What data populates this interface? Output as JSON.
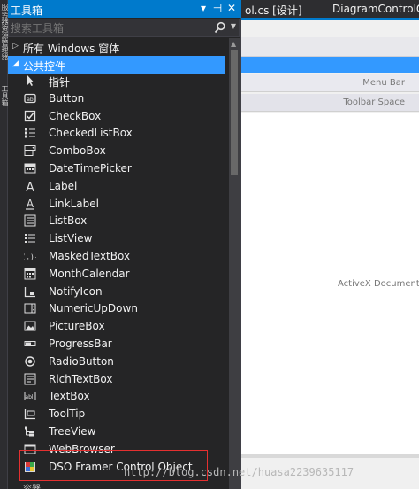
{
  "vertical_strip": {
    "labels": [
      "服务器资源管理器",
      "工具箱"
    ]
  },
  "toolbox": {
    "title": "工具箱",
    "controls": {
      "dropdown": "▾",
      "pin": "⊣",
      "close": "✕"
    },
    "search": {
      "placeholder": "搜索工具箱",
      "value": ""
    },
    "groups": {
      "windows": {
        "label": "所有 Windows 窗体",
        "expanded": false
      },
      "common": {
        "label": "公共控件",
        "expanded": true
      },
      "next": {
        "label": "容器"
      }
    },
    "items": [
      {
        "name": "指针",
        "icon": "pointer-icon"
      },
      {
        "name": "Button",
        "icon": "button-icon"
      },
      {
        "name": "CheckBox",
        "icon": "checkbox-icon"
      },
      {
        "name": "CheckedListBox",
        "icon": "checkedlistbox-icon"
      },
      {
        "name": "ComboBox",
        "icon": "combobox-icon"
      },
      {
        "name": "DateTimePicker",
        "icon": "datetimepicker-icon"
      },
      {
        "name": "Label",
        "icon": "label-icon"
      },
      {
        "name": "LinkLabel",
        "icon": "linklabel-icon"
      },
      {
        "name": "ListBox",
        "icon": "listbox-icon"
      },
      {
        "name": "ListView",
        "icon": "listview-icon"
      },
      {
        "name": "MaskedTextBox",
        "icon": "maskedtextbox-icon"
      },
      {
        "name": "MonthCalendar",
        "icon": "monthcalendar-icon"
      },
      {
        "name": "NotifyIcon",
        "icon": "notifyicon-icon"
      },
      {
        "name": "NumericUpDown",
        "icon": "numericupdown-icon"
      },
      {
        "name": "PictureBox",
        "icon": "picturebox-icon"
      },
      {
        "name": "ProgressBar",
        "icon": "progressbar-icon"
      },
      {
        "name": "RadioButton",
        "icon": "radiobutton-icon"
      },
      {
        "name": "RichTextBox",
        "icon": "richtextbox-icon"
      },
      {
        "name": "TextBox",
        "icon": "textbox-icon"
      },
      {
        "name": "ToolTip",
        "icon": "tooltip-icon"
      },
      {
        "name": "TreeView",
        "icon": "treeview-icon"
      },
      {
        "name": "WebBrowser",
        "icon": "webbrowser-icon"
      },
      {
        "name": "DSO Framer Control Object",
        "icon": "dso-framer-icon"
      }
    ]
  },
  "designer": {
    "tabs": [
      "ol.cs [设计]",
      "DiagramControlOp"
    ],
    "menu_bar_label": "Menu Bar",
    "toolbar_label": "Toolbar Space",
    "activex_label": "ActiveX Document Ob"
  },
  "watermark": "http://blog.csdn.net/huasa2239635117",
  "colors": {
    "accent": "#007acc",
    "selection": "#3399ff",
    "highlight_border": "#e53030",
    "panel_bg": "#252526"
  }
}
